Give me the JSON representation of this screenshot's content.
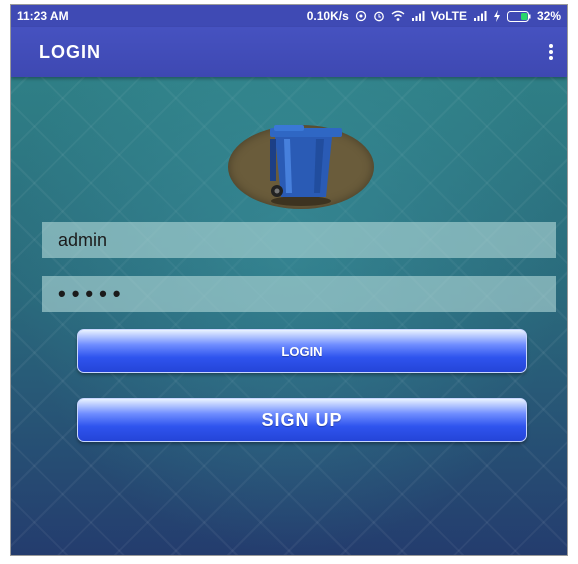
{
  "status_bar": {
    "time": "11:23 AM",
    "network_speed": "0.10K/s",
    "carrier": "VoLTE",
    "battery": "32%"
  },
  "app_bar": {
    "title": "LOGIN",
    "menu_icon": "more-vertical-icon"
  },
  "logo": {
    "icon": "trash-bin-icon"
  },
  "form": {
    "username_value": "admin",
    "password_mask": "•••••"
  },
  "buttons": {
    "login_label": "LOGIN",
    "signup_label": "SIGN UP"
  },
  "colors": {
    "app_bar": "#3f4ab4",
    "button_blue": "#2f54ee",
    "field_bg": "#b0d6d6",
    "background": "#2a6b78"
  }
}
